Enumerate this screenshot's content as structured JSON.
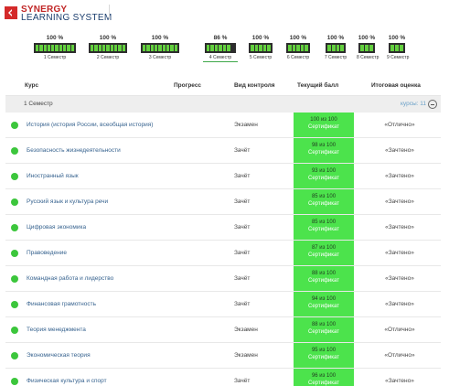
{
  "logo": {
    "line1": "SYNERGY",
    "line2": "LEARNING SYSTEM"
  },
  "semesters": [
    {
      "percent": "100 %",
      "label": "1 Семестр",
      "progress": 1.0
    },
    {
      "percent": "100 %",
      "label": "2 Семестр",
      "progress": 1.0
    },
    {
      "percent": "100 %",
      "label": "3 Семестр",
      "progress": 1.0
    },
    {
      "percent": "86 %",
      "label": "4 Семестр",
      "progress": 0.86
    },
    {
      "percent": "100 %",
      "label": "5 Семестр",
      "progress": 1.0
    },
    {
      "percent": "100 %",
      "label": "6 Семестр",
      "progress": 1.0
    },
    {
      "percent": "100 %",
      "label": "7 Семестр",
      "progress": 1.0
    },
    {
      "percent": "100 %",
      "label": "8 Семестр",
      "progress": 1.0
    },
    {
      "percent": "100 %",
      "label": "9 Семестр",
      "progress": 1.0
    }
  ],
  "table": {
    "headers": {
      "course": "Курс",
      "progress": "Прогресс",
      "control": "Вид контроля",
      "score": "Текущий балл",
      "grade": "Итоговая оценка"
    },
    "group": {
      "title": "1 Семестр",
      "count": "курсы: 11"
    },
    "rows": [
      {
        "course": "История (история России, всеобщая история)",
        "control": "Экзамен",
        "score": "100 из 100",
        "cert": "Сертификат",
        "grade": "«Отлично»"
      },
      {
        "course": "Безопасность жизнедеятельности",
        "control": "Зачёт",
        "score": "98 из 100",
        "cert": "Сертификат",
        "grade": "«Зачтено»"
      },
      {
        "course": "Иностранный язык",
        "control": "Зачёт",
        "score": "93 из 100",
        "cert": "Сертификат",
        "grade": "«Зачтено»"
      },
      {
        "course": "Русский язык и культура речи",
        "control": "Зачёт",
        "score": "85 из 100",
        "cert": "Сертификат",
        "grade": "«Зачтено»"
      },
      {
        "course": "Цифровая экономика",
        "control": "Зачёт",
        "score": "85 из 100",
        "cert": "Сертификат",
        "grade": "«Зачтено»"
      },
      {
        "course": "Правоведение",
        "control": "Зачёт",
        "score": "87 из 100",
        "cert": "Сертификат",
        "grade": "«Зачтено»"
      },
      {
        "course": "Командная работа и лидерство",
        "control": "Зачёт",
        "score": "88 из 100",
        "cert": "Сертификат",
        "grade": "«Зачтено»"
      },
      {
        "course": "Финансовая грамотность",
        "control": "Зачёт",
        "score": "94 из 100",
        "cert": "Сертификат",
        "grade": "«Зачтено»"
      },
      {
        "course": "Теория менеджмента",
        "control": "Экзамен",
        "score": "88 из 100",
        "cert": "Сертификат",
        "grade": "«Отлично»"
      },
      {
        "course": "Экономическая теория",
        "control": "Экзамен",
        "score": "95 из 100",
        "cert": "Сертификат",
        "grade": "«Отлично»"
      },
      {
        "course": "Физическая культура и спорт",
        "control": "Зачёт",
        "score": "96 из 100",
        "cert": "Сертификат",
        "grade": "«Зачтено»"
      }
    ]
  },
  "colors": {
    "accent_red": "#d42a2a",
    "brand_blue": "#1b3e6e",
    "progress_green": "#63d13e",
    "score_green": "#4ce34c",
    "status_dot": "#3cc63c",
    "link_blue": "#37638f"
  },
  "icons": {
    "collapse": "minus-circle-icon",
    "status": "status-dot-icon",
    "logo": "synergy-logo-icon"
  }
}
